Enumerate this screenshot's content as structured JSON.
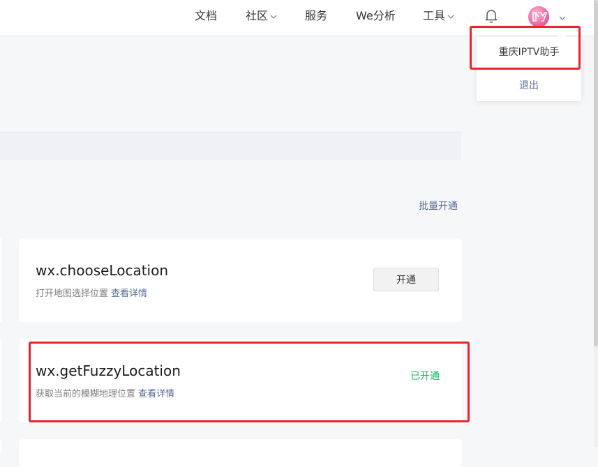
{
  "nav": {
    "docs": "文档",
    "community": "社区",
    "services": "服务",
    "analytics": "We分析",
    "tools": "工具"
  },
  "account_menu": {
    "account_name": "重庆IPTV助手",
    "logout": "退出"
  },
  "batch_enable_link": "批量开通",
  "apis": [
    {
      "name": "wx.chooseLocation",
      "description": "打开地图选择位置",
      "details_link": "查看详情",
      "action_label": "开通"
    },
    {
      "name": "wx.getFuzzyLocation",
      "description": "获取当前的模糊地理位置",
      "details_link": "查看详情",
      "status_label": "已开通"
    }
  ],
  "colors": {
    "link_blue": "#576b95",
    "enabled_green": "#07c160",
    "highlight_red": "#e8232b"
  },
  "icons": {
    "notifications": "bell-icon",
    "dropdown": "chevron-down-icon"
  }
}
